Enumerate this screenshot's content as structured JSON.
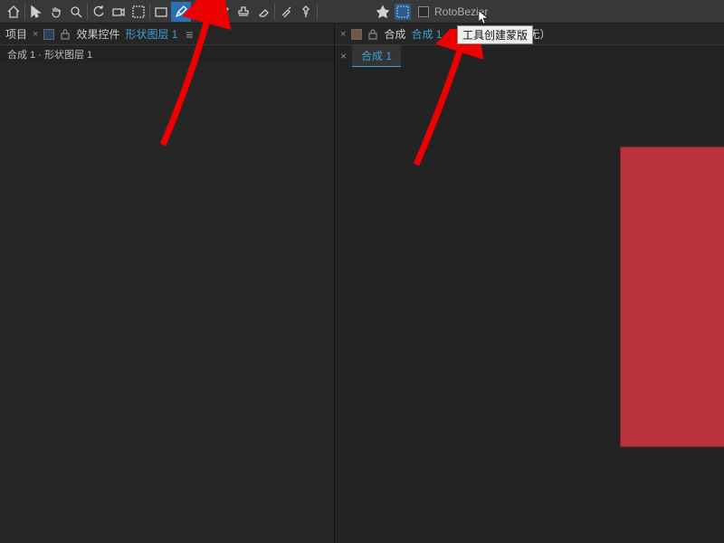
{
  "toolbar": {
    "rotobezier_label": "RotoBezier"
  },
  "tooltip": {
    "text": "工具创建蒙版"
  },
  "left": {
    "title": "项目",
    "effects_label": "效果控件",
    "shape_link": "形状图层 1",
    "sub": "合成 1 · 形状图层 1"
  },
  "right": {
    "comp_label": "合成",
    "comp_link": "合成 1",
    "none": "无）",
    "tab": "合成 1"
  },
  "colors": {
    "red_rect": "#b9343b",
    "swatch_left": "#2c3e66",
    "swatch_right": "#6b5a3f"
  }
}
